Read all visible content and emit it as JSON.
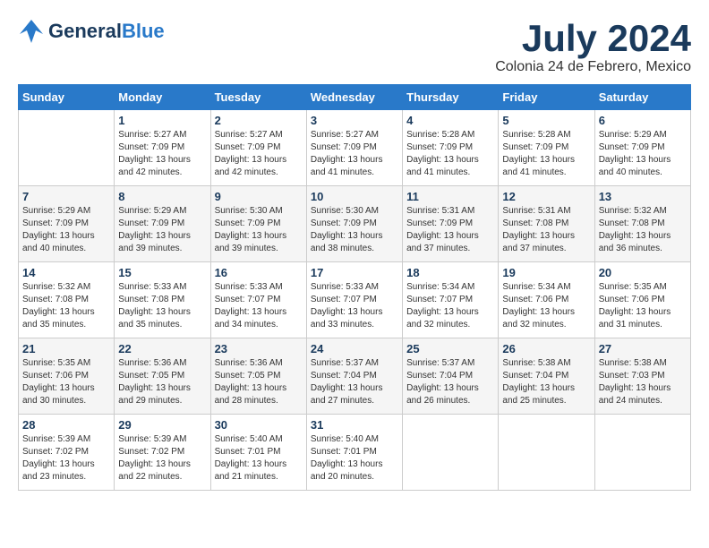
{
  "header": {
    "logo_line1": "General",
    "logo_line2": "Blue",
    "month": "July 2024",
    "location": "Colonia 24 de Febrero, Mexico"
  },
  "weekdays": [
    "Sunday",
    "Monday",
    "Tuesday",
    "Wednesday",
    "Thursday",
    "Friday",
    "Saturday"
  ],
  "weeks": [
    [
      {
        "day": "",
        "text": ""
      },
      {
        "day": "1",
        "text": "Sunrise: 5:27 AM\nSunset: 7:09 PM\nDaylight: 13 hours\nand 42 minutes."
      },
      {
        "day": "2",
        "text": "Sunrise: 5:27 AM\nSunset: 7:09 PM\nDaylight: 13 hours\nand 42 minutes."
      },
      {
        "day": "3",
        "text": "Sunrise: 5:27 AM\nSunset: 7:09 PM\nDaylight: 13 hours\nand 41 minutes."
      },
      {
        "day": "4",
        "text": "Sunrise: 5:28 AM\nSunset: 7:09 PM\nDaylight: 13 hours\nand 41 minutes."
      },
      {
        "day": "5",
        "text": "Sunrise: 5:28 AM\nSunset: 7:09 PM\nDaylight: 13 hours\nand 41 minutes."
      },
      {
        "day": "6",
        "text": "Sunrise: 5:29 AM\nSunset: 7:09 PM\nDaylight: 13 hours\nand 40 minutes."
      }
    ],
    [
      {
        "day": "7",
        "text": "Sunrise: 5:29 AM\nSunset: 7:09 PM\nDaylight: 13 hours\nand 40 minutes."
      },
      {
        "day": "8",
        "text": "Sunrise: 5:29 AM\nSunset: 7:09 PM\nDaylight: 13 hours\nand 39 minutes."
      },
      {
        "day": "9",
        "text": "Sunrise: 5:30 AM\nSunset: 7:09 PM\nDaylight: 13 hours\nand 39 minutes."
      },
      {
        "day": "10",
        "text": "Sunrise: 5:30 AM\nSunset: 7:09 PM\nDaylight: 13 hours\nand 38 minutes."
      },
      {
        "day": "11",
        "text": "Sunrise: 5:31 AM\nSunset: 7:09 PM\nDaylight: 13 hours\nand 37 minutes."
      },
      {
        "day": "12",
        "text": "Sunrise: 5:31 AM\nSunset: 7:08 PM\nDaylight: 13 hours\nand 37 minutes."
      },
      {
        "day": "13",
        "text": "Sunrise: 5:32 AM\nSunset: 7:08 PM\nDaylight: 13 hours\nand 36 minutes."
      }
    ],
    [
      {
        "day": "14",
        "text": "Sunrise: 5:32 AM\nSunset: 7:08 PM\nDaylight: 13 hours\nand 35 minutes."
      },
      {
        "day": "15",
        "text": "Sunrise: 5:33 AM\nSunset: 7:08 PM\nDaylight: 13 hours\nand 35 minutes."
      },
      {
        "day": "16",
        "text": "Sunrise: 5:33 AM\nSunset: 7:07 PM\nDaylight: 13 hours\nand 34 minutes."
      },
      {
        "day": "17",
        "text": "Sunrise: 5:33 AM\nSunset: 7:07 PM\nDaylight: 13 hours\nand 33 minutes."
      },
      {
        "day": "18",
        "text": "Sunrise: 5:34 AM\nSunset: 7:07 PM\nDaylight: 13 hours\nand 32 minutes."
      },
      {
        "day": "19",
        "text": "Sunrise: 5:34 AM\nSunset: 7:06 PM\nDaylight: 13 hours\nand 32 minutes."
      },
      {
        "day": "20",
        "text": "Sunrise: 5:35 AM\nSunset: 7:06 PM\nDaylight: 13 hours\nand 31 minutes."
      }
    ],
    [
      {
        "day": "21",
        "text": "Sunrise: 5:35 AM\nSunset: 7:06 PM\nDaylight: 13 hours\nand 30 minutes."
      },
      {
        "day": "22",
        "text": "Sunrise: 5:36 AM\nSunset: 7:05 PM\nDaylight: 13 hours\nand 29 minutes."
      },
      {
        "day": "23",
        "text": "Sunrise: 5:36 AM\nSunset: 7:05 PM\nDaylight: 13 hours\nand 28 minutes."
      },
      {
        "day": "24",
        "text": "Sunrise: 5:37 AM\nSunset: 7:04 PM\nDaylight: 13 hours\nand 27 minutes."
      },
      {
        "day": "25",
        "text": "Sunrise: 5:37 AM\nSunset: 7:04 PM\nDaylight: 13 hours\nand 26 minutes."
      },
      {
        "day": "26",
        "text": "Sunrise: 5:38 AM\nSunset: 7:04 PM\nDaylight: 13 hours\nand 25 minutes."
      },
      {
        "day": "27",
        "text": "Sunrise: 5:38 AM\nSunset: 7:03 PM\nDaylight: 13 hours\nand 24 minutes."
      }
    ],
    [
      {
        "day": "28",
        "text": "Sunrise: 5:39 AM\nSunset: 7:02 PM\nDaylight: 13 hours\nand 23 minutes."
      },
      {
        "day": "29",
        "text": "Sunrise: 5:39 AM\nSunset: 7:02 PM\nDaylight: 13 hours\nand 22 minutes."
      },
      {
        "day": "30",
        "text": "Sunrise: 5:40 AM\nSunset: 7:01 PM\nDaylight: 13 hours\nand 21 minutes."
      },
      {
        "day": "31",
        "text": "Sunrise: 5:40 AM\nSunset: 7:01 PM\nDaylight: 13 hours\nand 20 minutes."
      },
      {
        "day": "",
        "text": ""
      },
      {
        "day": "",
        "text": ""
      },
      {
        "day": "",
        "text": ""
      }
    ]
  ]
}
